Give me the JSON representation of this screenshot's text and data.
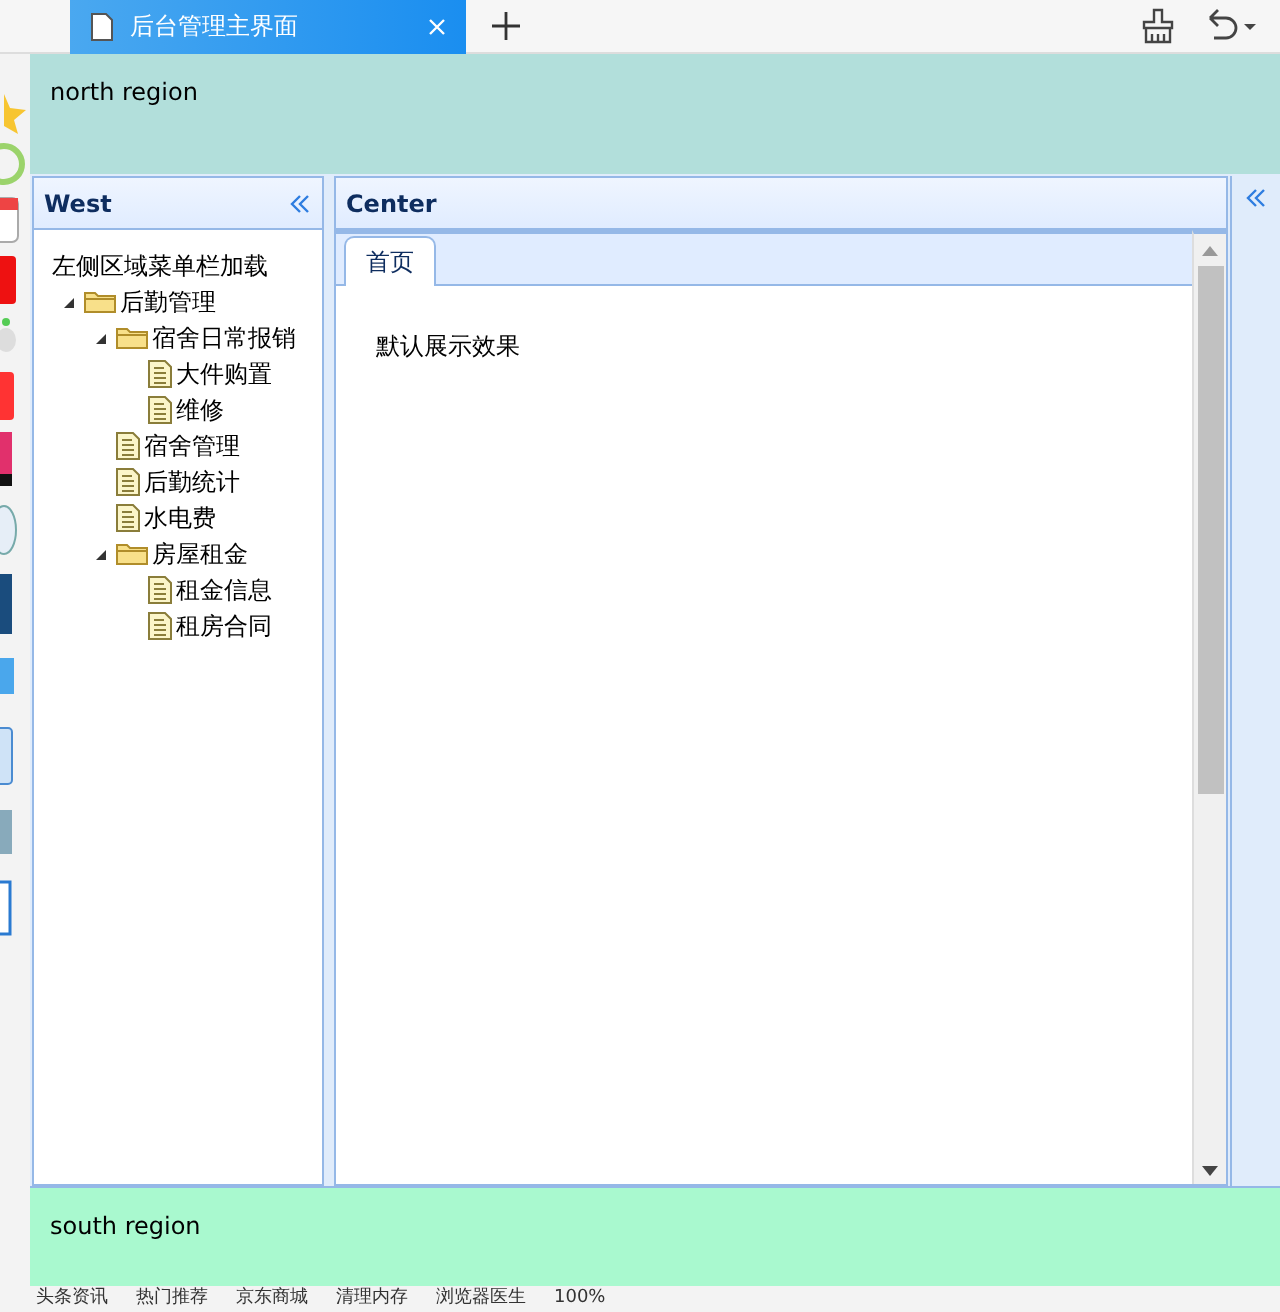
{
  "browser_tab": {
    "title": "后台管理主界面",
    "selected": true
  },
  "north": {
    "text": "north region"
  },
  "west": {
    "title": "West",
    "menu_title": "左侧区域菜单栏加载",
    "tree": [
      {
        "label": "后勤管理",
        "kind": "folder",
        "expanded": true,
        "children": [
          {
            "label": "宿舍日常报销",
            "kind": "folder",
            "expanded": true,
            "children": [
              {
                "label": "大件购置",
                "kind": "file"
              },
              {
                "label": "维修",
                "kind": "file"
              }
            ]
          },
          {
            "label": "宿舍管理",
            "kind": "file"
          },
          {
            "label": "后勤统计",
            "kind": "file"
          },
          {
            "label": "水电费",
            "kind": "file"
          },
          {
            "label": "房屋租金",
            "kind": "folder",
            "expanded": true,
            "children": [
              {
                "label": "租金信息",
                "kind": "file"
              },
              {
                "label": "租房合同",
                "kind": "file"
              }
            ]
          }
        ]
      }
    ]
  },
  "center": {
    "title": "Center",
    "tabs": [
      {
        "label": "首页",
        "selected": true
      }
    ],
    "content": "默认展示效果"
  },
  "south": {
    "text": "south region"
  },
  "status_bar": [
    "头条资讯",
    "热门推荐",
    "京东商城",
    "清理内存",
    "浏览器医生",
    "100%"
  ]
}
